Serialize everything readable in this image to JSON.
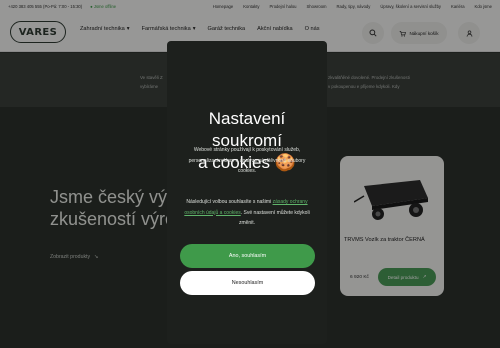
{
  "topbar": {
    "contact": "+420 383 405 555 (Po-Pá: 7:00 - 15:30)",
    "status": "● Jsme offline",
    "links": [
      "Homepage",
      "Kontakty",
      "Prodejní halou",
      "Showroom",
      "Rady, tipy, návody",
      "Úpravy, školení a servisní služby",
      "Kariéra",
      "Kdo jsme"
    ]
  },
  "logo": {
    "text": "VARES"
  },
  "nav": {
    "items": [
      {
        "label": "Zahradní technika",
        "has_dropdown": true
      },
      {
        "label": "Farmářská technika",
        "has_dropdown": true
      },
      {
        "label": "Garáž technika",
        "has_dropdown": false
      },
      {
        "label": "Akční nabídka",
        "has_dropdown": false
      },
      {
        "label": "O nás",
        "has_dropdown": false
      }
    ],
    "cart_label": "Nákupní košík"
  },
  "banner": {
    "left_text_1": "Ve stavěli Z",
    "left_text_2": "vybíráme",
    "right_text_1": "zkvalitňěné dovolené. Prodejní zkušenosti",
    "right_text_2": "v pokoupenou e přijeme kdykoli. Kdy"
  },
  "hero": {
    "title_line_1": "Jsme český výr",
    "title_line_2": "zkušeností výro",
    "link": "Zobrazit produkty"
  },
  "product_card": {
    "title": "TRVMS Vozík za traktor ČERNÁ",
    "price": "6 920 Kč",
    "button": "Detail produktu"
  },
  "modal": {
    "title_line_1": "Nastavení",
    "title_line_2": "soukromí",
    "title_line_3": "a cookies",
    "cookie_emoji": "🍪",
    "description": "Webové stránky používají k poskytování služeb, personalizaci reklam a analýze návštěvnosti soubory cookies.",
    "consent_prefix": "Následující volbou souhlasíte s našimi",
    "consent_link": "zásady ochrany osobních údajů a cookies",
    "consent_suffix": "Své nastavení můžete kdykoli změnit.",
    "accept_label": "Ano, souhlasím",
    "reject_label": "Nesouhlasím"
  },
  "colors": {
    "accent": "#3f9a4a",
    "dark_bg": "#2c312d",
    "modal_bg": "#1d201d"
  }
}
